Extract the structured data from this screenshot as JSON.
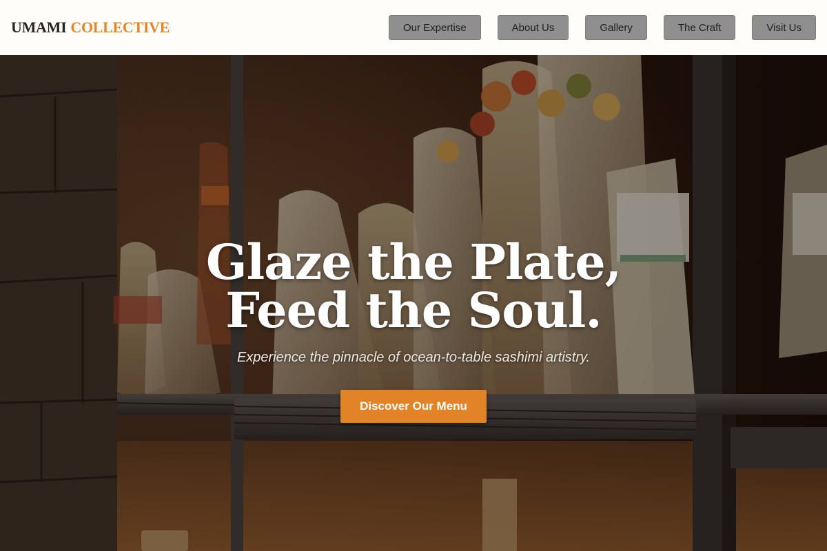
{
  "brand": {
    "word1": "UMAMI",
    "word2": "COLLECTIVE"
  },
  "nav": {
    "items": [
      {
        "label": "Our Expertise"
      },
      {
        "label": "About Us"
      },
      {
        "label": "Gallery"
      },
      {
        "label": "The Craft"
      },
      {
        "label": "Visit Us"
      }
    ]
  },
  "hero": {
    "headline_line1": "Glaze the Plate,",
    "headline_line2": "Feed the Soul.",
    "subheadline": "Experience the pinnacle of ocean-to-table sashimi artistry.",
    "cta_label": "Discover Our Menu"
  },
  "colors": {
    "accent": "#e38327",
    "header_bg": "#fefdfa",
    "nav_button_bg": "#8f8f8f"
  }
}
